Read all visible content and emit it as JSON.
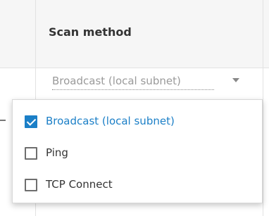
{
  "column_header": {
    "title": "Scan method"
  },
  "scan_method_select": {
    "selected_value": "Broadcast (local subnet)",
    "arrow_icon": "caret-down-icon"
  },
  "scan_method_options": [
    {
      "label": "Broadcast (local subnet)",
      "checked": true
    },
    {
      "label": "Ping",
      "checked": false
    },
    {
      "label": "TCP Connect",
      "checked": false
    }
  ],
  "colors": {
    "accent": "#1b7fc7",
    "header_bg": "#f6f6f6",
    "muted_text": "#9a9a9a",
    "text": "#333333"
  }
}
